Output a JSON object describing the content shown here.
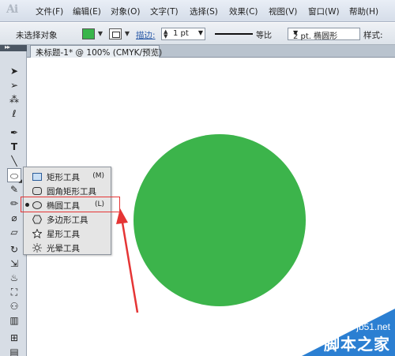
{
  "app": {
    "logo": "Ai"
  },
  "menubar": {
    "items": [
      "文件(F)",
      "编辑(E)",
      "对象(O)",
      "文字(T)",
      "选择(S)",
      "效果(C)",
      "视图(V)",
      "窗口(W)",
      "帮助(H)"
    ]
  },
  "controlbar": {
    "selection_status": "未选择对象",
    "fill_color": "#39b54a",
    "stroke_label": "描边:",
    "stroke_weight": "1 pt",
    "line_style_label": "等比",
    "brush_label": "2 pt. 椭圆形",
    "style_label": "样式:"
  },
  "document": {
    "tab_title": "未标题-1* @ 100% (CMYK/预览)",
    "close_glyph": "×"
  },
  "canvas": {
    "ellipse_color": "#3cb44b"
  },
  "tool_flyout": {
    "items": [
      {
        "label": "矩形工具",
        "shortcut": "(M)",
        "icon": "rectangle-icon"
      },
      {
        "label": "圆角矩形工具",
        "shortcut": "",
        "icon": "rounded-rectangle-icon"
      },
      {
        "label": "椭圆工具",
        "shortcut": "(L)",
        "icon": "ellipse-icon"
      },
      {
        "label": "多边形工具",
        "shortcut": "",
        "icon": "polygon-icon"
      },
      {
        "label": "星形工具",
        "shortcut": "",
        "icon": "star-icon"
      },
      {
        "label": "光晕工具",
        "shortcut": "",
        "icon": "flare-icon"
      }
    ],
    "highlight_color": "#e53535"
  },
  "watermark": {
    "site": "jb51.net",
    "title": "脚本之家"
  }
}
